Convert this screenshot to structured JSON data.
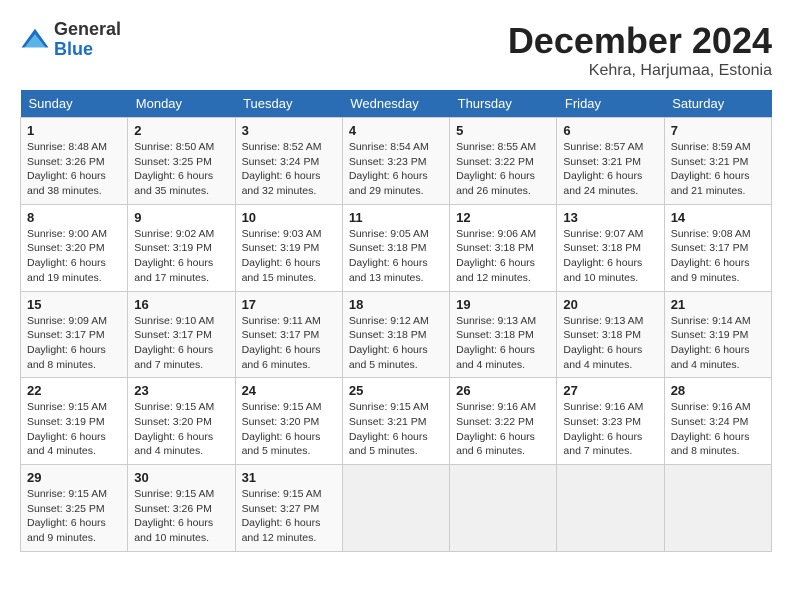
{
  "header": {
    "logo_general": "General",
    "logo_blue": "Blue",
    "month_title": "December 2024",
    "location": "Kehra, Harjumaa, Estonia"
  },
  "days_of_week": [
    "Sunday",
    "Monday",
    "Tuesday",
    "Wednesday",
    "Thursday",
    "Friday",
    "Saturday"
  ],
  "weeks": [
    [
      {
        "num": "1",
        "sunrise": "Sunrise: 8:48 AM",
        "sunset": "Sunset: 3:26 PM",
        "daylight": "Daylight: 6 hours and 38 minutes."
      },
      {
        "num": "2",
        "sunrise": "Sunrise: 8:50 AM",
        "sunset": "Sunset: 3:25 PM",
        "daylight": "Daylight: 6 hours and 35 minutes."
      },
      {
        "num": "3",
        "sunrise": "Sunrise: 8:52 AM",
        "sunset": "Sunset: 3:24 PM",
        "daylight": "Daylight: 6 hours and 32 minutes."
      },
      {
        "num": "4",
        "sunrise": "Sunrise: 8:54 AM",
        "sunset": "Sunset: 3:23 PM",
        "daylight": "Daylight: 6 hours and 29 minutes."
      },
      {
        "num": "5",
        "sunrise": "Sunrise: 8:55 AM",
        "sunset": "Sunset: 3:22 PM",
        "daylight": "Daylight: 6 hours and 26 minutes."
      },
      {
        "num": "6",
        "sunrise": "Sunrise: 8:57 AM",
        "sunset": "Sunset: 3:21 PM",
        "daylight": "Daylight: 6 hours and 24 minutes."
      },
      {
        "num": "7",
        "sunrise": "Sunrise: 8:59 AM",
        "sunset": "Sunset: 3:21 PM",
        "daylight": "Daylight: 6 hours and 21 minutes."
      }
    ],
    [
      {
        "num": "8",
        "sunrise": "Sunrise: 9:00 AM",
        "sunset": "Sunset: 3:20 PM",
        "daylight": "Daylight: 6 hours and 19 minutes."
      },
      {
        "num": "9",
        "sunrise": "Sunrise: 9:02 AM",
        "sunset": "Sunset: 3:19 PM",
        "daylight": "Daylight: 6 hours and 17 minutes."
      },
      {
        "num": "10",
        "sunrise": "Sunrise: 9:03 AM",
        "sunset": "Sunset: 3:19 PM",
        "daylight": "Daylight: 6 hours and 15 minutes."
      },
      {
        "num": "11",
        "sunrise": "Sunrise: 9:05 AM",
        "sunset": "Sunset: 3:18 PM",
        "daylight": "Daylight: 6 hours and 13 minutes."
      },
      {
        "num": "12",
        "sunrise": "Sunrise: 9:06 AM",
        "sunset": "Sunset: 3:18 PM",
        "daylight": "Daylight: 6 hours and 12 minutes."
      },
      {
        "num": "13",
        "sunrise": "Sunrise: 9:07 AM",
        "sunset": "Sunset: 3:18 PM",
        "daylight": "Daylight: 6 hours and 10 minutes."
      },
      {
        "num": "14",
        "sunrise": "Sunrise: 9:08 AM",
        "sunset": "Sunset: 3:17 PM",
        "daylight": "Daylight: 6 hours and 9 minutes."
      }
    ],
    [
      {
        "num": "15",
        "sunrise": "Sunrise: 9:09 AM",
        "sunset": "Sunset: 3:17 PM",
        "daylight": "Daylight: 6 hours and 8 minutes."
      },
      {
        "num": "16",
        "sunrise": "Sunrise: 9:10 AM",
        "sunset": "Sunset: 3:17 PM",
        "daylight": "Daylight: 6 hours and 7 minutes."
      },
      {
        "num": "17",
        "sunrise": "Sunrise: 9:11 AM",
        "sunset": "Sunset: 3:17 PM",
        "daylight": "Daylight: 6 hours and 6 minutes."
      },
      {
        "num": "18",
        "sunrise": "Sunrise: 9:12 AM",
        "sunset": "Sunset: 3:18 PM",
        "daylight": "Daylight: 6 hours and 5 minutes."
      },
      {
        "num": "19",
        "sunrise": "Sunrise: 9:13 AM",
        "sunset": "Sunset: 3:18 PM",
        "daylight": "Daylight: 6 hours and 4 minutes."
      },
      {
        "num": "20",
        "sunrise": "Sunrise: 9:13 AM",
        "sunset": "Sunset: 3:18 PM",
        "daylight": "Daylight: 6 hours and 4 minutes."
      },
      {
        "num": "21",
        "sunrise": "Sunrise: 9:14 AM",
        "sunset": "Sunset: 3:19 PM",
        "daylight": "Daylight: 6 hours and 4 minutes."
      }
    ],
    [
      {
        "num": "22",
        "sunrise": "Sunrise: 9:15 AM",
        "sunset": "Sunset: 3:19 PM",
        "daylight": "Daylight: 6 hours and 4 minutes."
      },
      {
        "num": "23",
        "sunrise": "Sunrise: 9:15 AM",
        "sunset": "Sunset: 3:20 PM",
        "daylight": "Daylight: 6 hours and 4 minutes."
      },
      {
        "num": "24",
        "sunrise": "Sunrise: 9:15 AM",
        "sunset": "Sunset: 3:20 PM",
        "daylight": "Daylight: 6 hours and 5 minutes."
      },
      {
        "num": "25",
        "sunrise": "Sunrise: 9:15 AM",
        "sunset": "Sunset: 3:21 PM",
        "daylight": "Daylight: 6 hours and 5 minutes."
      },
      {
        "num": "26",
        "sunrise": "Sunrise: 9:16 AM",
        "sunset": "Sunset: 3:22 PM",
        "daylight": "Daylight: 6 hours and 6 minutes."
      },
      {
        "num": "27",
        "sunrise": "Sunrise: 9:16 AM",
        "sunset": "Sunset: 3:23 PM",
        "daylight": "Daylight: 6 hours and 7 minutes."
      },
      {
        "num": "28",
        "sunrise": "Sunrise: 9:16 AM",
        "sunset": "Sunset: 3:24 PM",
        "daylight": "Daylight: 6 hours and 8 minutes."
      }
    ],
    [
      {
        "num": "29",
        "sunrise": "Sunrise: 9:15 AM",
        "sunset": "Sunset: 3:25 PM",
        "daylight": "Daylight: 6 hours and 9 minutes."
      },
      {
        "num": "30",
        "sunrise": "Sunrise: 9:15 AM",
        "sunset": "Sunset: 3:26 PM",
        "daylight": "Daylight: 6 hours and 10 minutes."
      },
      {
        "num": "31",
        "sunrise": "Sunrise: 9:15 AM",
        "sunset": "Sunset: 3:27 PM",
        "daylight": "Daylight: 6 hours and 12 minutes."
      },
      null,
      null,
      null,
      null
    ]
  ]
}
